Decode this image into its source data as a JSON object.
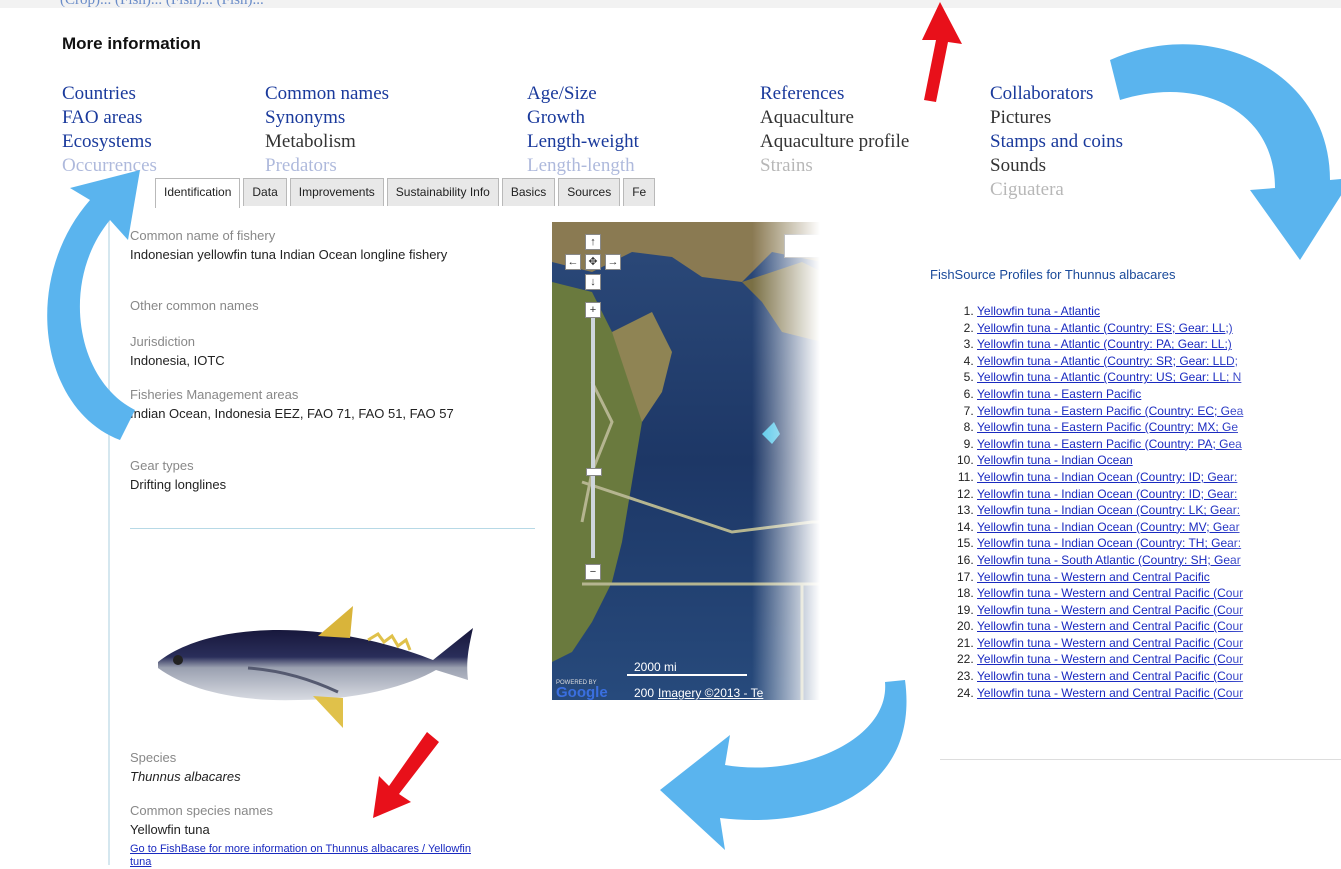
{
  "more_information": {
    "title": "More information",
    "columns": [
      [
        {
          "label": "Countries",
          "link": true
        },
        {
          "label": "FAO areas",
          "link": true
        },
        {
          "label": "Ecosystems",
          "link": true
        },
        {
          "label": "Occurrences",
          "link": true,
          "faded": true
        }
      ],
      [
        {
          "label": "Common names",
          "link": true
        },
        {
          "label": "Synonyms",
          "link": true
        },
        {
          "label": "Metabolism",
          "link": false
        },
        {
          "label": "Predators",
          "link": true,
          "faded": true
        }
      ],
      [
        {
          "label": "Age/Size",
          "link": true
        },
        {
          "label": "Growth",
          "link": true
        },
        {
          "label": "Length-weight",
          "link": true
        },
        {
          "label": "Length-length",
          "link": true,
          "faded": true
        }
      ],
      [
        {
          "label": "References",
          "link": true
        },
        {
          "label": "Aquaculture",
          "link": false
        },
        {
          "label": "Aquaculture profile",
          "link": false
        },
        {
          "label": "Strains",
          "link": false,
          "faded": true
        }
      ],
      [
        {
          "label": "Collaborators",
          "link": true
        },
        {
          "label": "Pictures",
          "link": false
        },
        {
          "label": "Stamps and coins",
          "link": true
        },
        {
          "label": "Sounds",
          "link": false
        },
        {
          "label": "Ciguatera",
          "link": false,
          "faded": true
        }
      ]
    ]
  },
  "tabs": [
    "Identification",
    "Data",
    "Improvements",
    "Sustainability Info",
    "Basics",
    "Sources",
    "Fe"
  ],
  "active_tab": "Identification",
  "identification": {
    "common_name_label": "Common name of fishery",
    "common_name_value": "Indonesian yellowfin tuna Indian Ocean longline fishery",
    "other_names_label": "Other common names",
    "jurisdiction_label": "Jurisdiction",
    "jurisdiction_value": "Indonesia, IOTC",
    "areas_label": "Fisheries Management areas",
    "areas_value": "Indian Ocean, Indonesia EEZ, FAO 71, FAO 51, FAO 57",
    "gear_label": "Gear types",
    "gear_value": "Drifting longlines",
    "species_label": "Species",
    "species_value": "Thunnus albacares",
    "species_names_label": "Common species names",
    "species_names_value": "Yellowfin tuna",
    "fishbase_link": "Go to FishBase for more information on Thunnus albacares / Yellowfin tuna"
  },
  "map": {
    "powered_by": "POWERED BY",
    "google": "Google",
    "scale_label": "2000 mi",
    "scale_label_2": "200",
    "imagery": "Imagery ©2013 - Te"
  },
  "fishsource": {
    "title": "FishSource Profiles for Thunnus albacares",
    "items": [
      "Yellowfin tuna - Atlantic",
      "Yellowfin tuna - Atlantic (Country: ES; Gear: LL;)",
      "Yellowfin tuna - Atlantic (Country: PA; Gear: LL;)",
      "Yellowfin tuna - Atlantic (Country: SR; Gear: LLD;",
      "Yellowfin tuna - Atlantic (Country: US; Gear: LL; N",
      "Yellowfin tuna - Eastern Pacific",
      "Yellowfin tuna - Eastern Pacific (Country: EC; Gea",
      "Yellowfin tuna - Eastern Pacific (Country: MX; Ge",
      "Yellowfin tuna - Eastern Pacific (Country: PA; Gea",
      "Yellowfin tuna - Indian Ocean",
      "Yellowfin tuna - Indian Ocean (Country: ID; Gear:",
      "Yellowfin tuna - Indian Ocean (Country: ID; Gear:",
      "Yellowfin tuna - Indian Ocean (Country: LK; Gear:",
      "Yellowfin tuna - Indian Ocean (Country: MV; Gear",
      "Yellowfin tuna - Indian Ocean (Country: TH; Gear:",
      "Yellowfin tuna - South Atlantic (Country: SH; Gear",
      "Yellowfin tuna - Western and Central Pacific",
      "Yellowfin tuna - Western and Central Pacific (Cour",
      "Yellowfin tuna - Western and Central Pacific (Cour",
      "Yellowfin tuna - Western and Central Pacific (Cour",
      "Yellowfin tuna - Western and Central Pacific (Cour",
      "Yellowfin tuna - Western and Central Pacific (Cour",
      "Yellowfin tuna - Western and Central Pacific (Cour",
      "Yellowfin tuna - Western and Central Pacific (Cour"
    ]
  },
  "colors": {
    "link": "#1a3a9c",
    "arrow_blue": "#5ab4ee",
    "arrow_red": "#e8101a"
  }
}
